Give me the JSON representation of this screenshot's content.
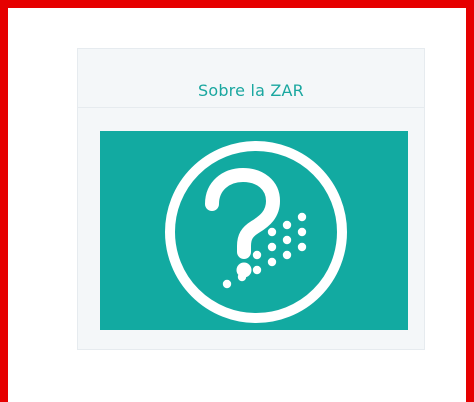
{
  "card": {
    "title": "Sobre la ZAR",
    "image_icon": "question-mark-with-dots-icon",
    "colors": {
      "frame_border": "#e60000",
      "title_text": "#1aa7a0",
      "image_background": "#12aaa1",
      "icon_foreground": "#ffffff"
    }
  }
}
